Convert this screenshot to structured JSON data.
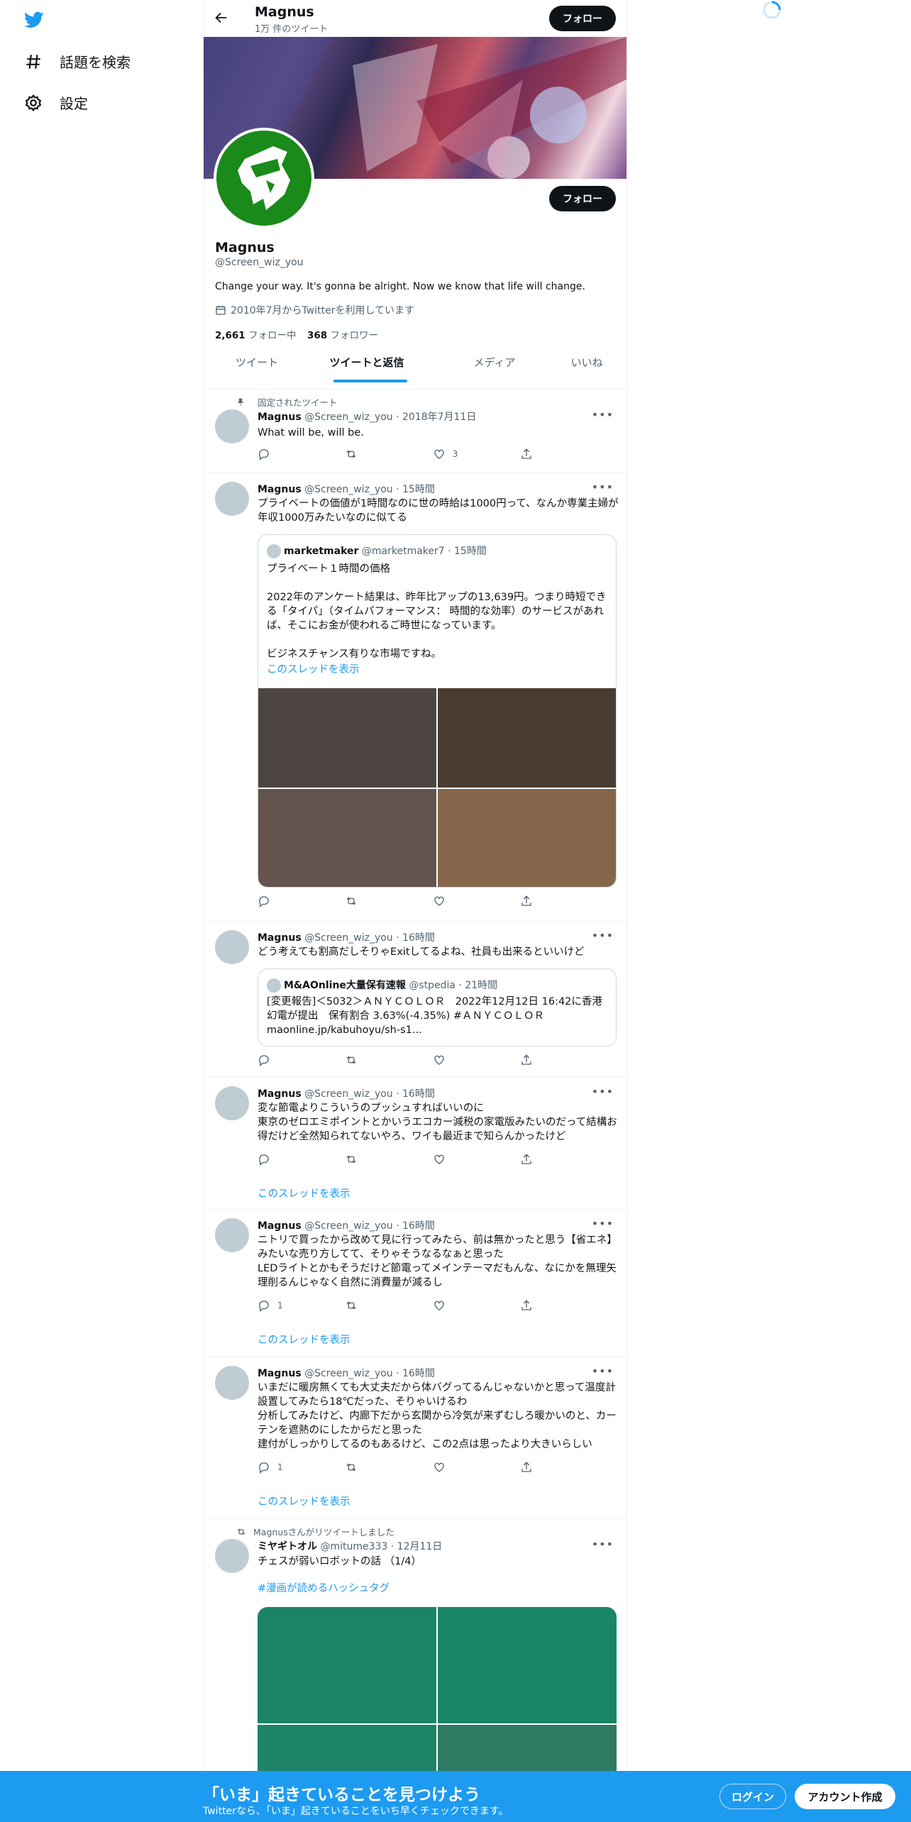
{
  "nav": {
    "explore_label": "話題を検索",
    "settings_label": "設定"
  },
  "header": {
    "name": "Magnus",
    "tweet_count": "1万 件のツイート",
    "follow_label": "フォロー"
  },
  "profile": {
    "display_name": "Magnus",
    "handle": "@Screen_wiz_you",
    "bio": "Change your way. It's gonna be alright. Now we know that life will change.",
    "joined": "2010年7月からTwitterを利用しています",
    "following_count": "2,661",
    "following_label": "フォロー中",
    "followers_count": "368",
    "followers_label": "フォロワー",
    "follow_label": "フォロー"
  },
  "tabs": [
    "ツイート",
    "ツイートと返信",
    "メディア",
    "いいね"
  ],
  "tweets": [
    {
      "pinned_label": "固定されたツイート",
      "name": "Magnus",
      "meta": "@Screen_wiz_you · 2018年7月11日",
      "text": "What will be, will be.",
      "likes": "3"
    },
    {
      "name": "Magnus",
      "meta": "@Screen_wiz_you · 15時間",
      "text": "プライベートの価値が1時間なのに世の時給は1000円って、なんか専業主婦が年収1000万みたいなのに似てる",
      "quote": {
        "name": "marketmaker",
        "meta": "@marketmaker7 · 15時間",
        "line1": "プライベート１時間の価格",
        "line2": "2022年のアンケート結果は、昨年比アップの13,639円。つまり時短できる「タイパ」（タイムパフォーマンス： 時間的な効率）のサービスがあれば、そこにお金が使われるご時世になっています。",
        "line3": "ビジネスチャンス有りな市場ですね。",
        "thread_link": "このスレッドを表示"
      },
      "image_colors": [
        "#4e4542",
        "#4a3b32",
        "#64544f",
        "#86664a"
      ]
    },
    {
      "name": "Magnus",
      "meta": "@Screen_wiz_you · 16時間",
      "text": "どう考えても割高だしそりゃExitしてるよね、社員も出来るといいけど",
      "quote": {
        "name": "M&AOnline大量保有速報",
        "meta": "@stpedia · 21時間",
        "text": "[変更報告]＜5032＞ＡＮＹＣＯＬＯＲ　2022年12月12日 16:42に香港幻電が提出　保有割合 3.63%(-4.35%) #ＡＮＹＣＯＬＯＲ maonline.jp/kabuhoyu/sh-s1..."
      }
    },
    {
      "name": "Magnus",
      "meta": "@Screen_wiz_you · 16時間",
      "text": "変な節電よりこういうのプッシュすればいいのに\n東京のゼロエミポイントとかいうエコカー減税の家電版みたいのだって結構お得だけど全然知られてないやろ、ワイも最近まで知らんかったけど",
      "thread_link": "このスレッドを表示"
    },
    {
      "name": "Magnus",
      "meta": "@Screen_wiz_you · 16時間",
      "text": "ニトリで買ったから改めて見に行ってみたら、前は無かったと思う【省エネ】みたいな売り方してて、そりゃそうなるなぁと思った\nLEDライトとかもそうだけど節電ってメインテーマだもんな、なにかを無理矢理削るんじゃなく自然に消費量が減るし",
      "replies": "1",
      "thread_link": "このスレッドを表示"
    },
    {
      "name": "Magnus",
      "meta": "@Screen_wiz_you · 16時間",
      "text": "いまだに暖房無くても大丈夫だから体バグってるんじゃないかと思って温度計設置してみたら18℃だった、そりゃいけるわ\n分析してみたけど、内廊下だから玄関から冷気が来ずむしろ暖かいのと、カーテンを遮熱のにしたからだと思った\n建付がしっかりしてるのもあるけど、この2点は思ったより大きいらしい",
      "replies": "1",
      "thread_link": "このスレッドを表示"
    },
    {
      "retweet_label": "Magnusさんがリツイートしました",
      "name": "ミヤギトオル",
      "meta": "@mitume333 · 12月11日",
      "text": "チェスが弱いロボットの話 （1/4）",
      "hashtag": "#漫画が読めるハッシュタグ",
      "image_colors": [
        "#1b8467",
        "#198667",
        "#1e8468",
        "#2e7a62"
      ]
    }
  ],
  "bottom_bar": {
    "title": "「いま」起きていることを見つけよう",
    "subtitle": "Twitterなら、「いま」起きていることをいち早くチェックできます。",
    "login_label": "ログイン",
    "signup_label": "アカウント作成"
  },
  "colors": {
    "accent": "#1d9bf0",
    "avatar_bg": "#1a8a1a"
  }
}
